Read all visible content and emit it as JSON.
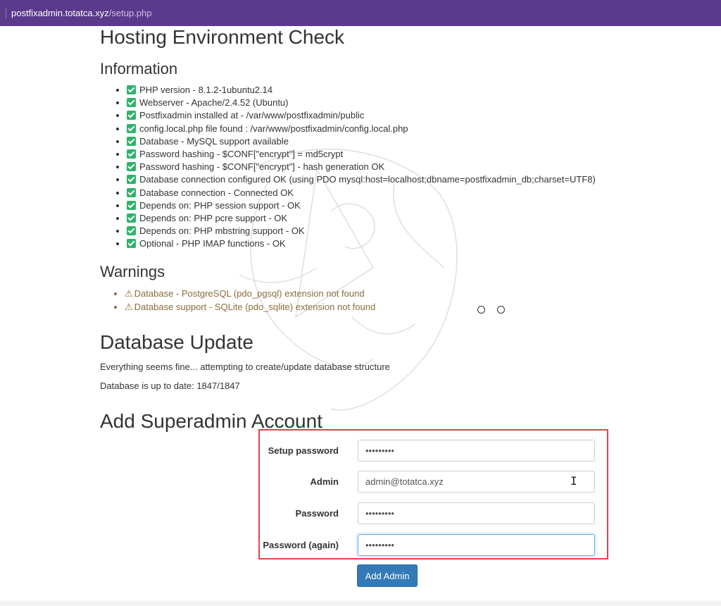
{
  "browser": {
    "url_host": "postfixadmin.totatca.xyz",
    "url_path": "/setup.php"
  },
  "hosting": {
    "title": "Hosting Environment Check",
    "info_heading": "Information",
    "checks": [
      "PHP version - 8.1.2-1ubuntu2.14",
      "Webserver - Apache/2.4.52 (Ubuntu)",
      "Postfixadmin installed at - /var/www/postfixadmin/public",
      "config.local.php file found : /var/www/postfixadmin/config.local.php",
      "Database - MySQL support available",
      "Password hashing - $CONF[\"encrypt\"] = md5crypt",
      "Password hashing - $CONF[\"encrypt\"] - hash generation OK",
      "Database connection configured OK (using PDO mysql:host=localhost;dbname=postfixadmin_db;charset=UTF8)",
      "Database connection - Connected OK",
      "Depends on: PHP session support - OK",
      "Depends on: PHP pcre support - OK",
      "Depends on: PHP mbstring support - OK",
      "Optional - PHP IMAP functions - OK"
    ],
    "warnings_heading": "Warnings",
    "warnings": [
      "Database - PostgreSQL (pdo_pgsql) extension not found",
      "Database support - SQLite (pdo_sqlite) extension not found"
    ],
    "warning_icon": "⚠"
  },
  "db_update": {
    "title": "Database Update",
    "line1": "Everything seems fine... attempting to create/update database structure",
    "line2": "Database is up to date: 1847/1847"
  },
  "superadmin": {
    "title": "Add Superadmin Account",
    "fields": [
      {
        "label": "Setup password",
        "value": "•••••••••",
        "type": "password"
      },
      {
        "label": "Admin",
        "value": "admin@totatca.xyz",
        "type": "text"
      },
      {
        "label": "Password",
        "value": "•••••••••",
        "type": "password"
      },
      {
        "label": "Password (again)",
        "value": "•••••••••",
        "type": "password"
      }
    ],
    "submit_label": "Add Admin"
  },
  "colors": {
    "urlbar": "#5b3a8c",
    "check": "#2fb36a",
    "warning_text": "#8a6d3b",
    "button": "#337ab7",
    "highlight_border": "#e04545"
  }
}
